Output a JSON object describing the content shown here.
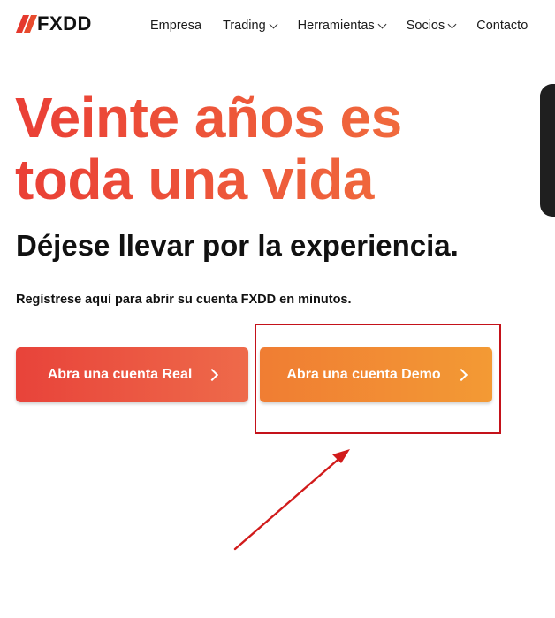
{
  "header": {
    "logo_text": "FXDD",
    "nav": [
      {
        "label": "Empresa",
        "has_dropdown": false
      },
      {
        "label": "Trading",
        "has_dropdown": true
      },
      {
        "label": "Herramientas",
        "has_dropdown": true
      },
      {
        "label": "Socios",
        "has_dropdown": true
      },
      {
        "label": "Contacto",
        "has_dropdown": false
      }
    ]
  },
  "hero": {
    "title_line1": "Veinte años es",
    "title_line2": "toda una vida",
    "subtitle": "Déjese llevar por la experiencia.",
    "note": "Regístrese aquí para abrir su cuenta FXDD en minutos."
  },
  "buttons": {
    "real_label": "Abra una cuenta Real",
    "demo_label": "Abra una cuenta Demo"
  },
  "colors": {
    "accent_red": "#e8433a",
    "accent_orange": "#f39a34",
    "annotation_red": "#c4121a"
  },
  "icons": {
    "logo": "fxdd-slash-logo",
    "dropdown": "chevron-down-icon",
    "button_arrow": "chevron-right-icon"
  }
}
